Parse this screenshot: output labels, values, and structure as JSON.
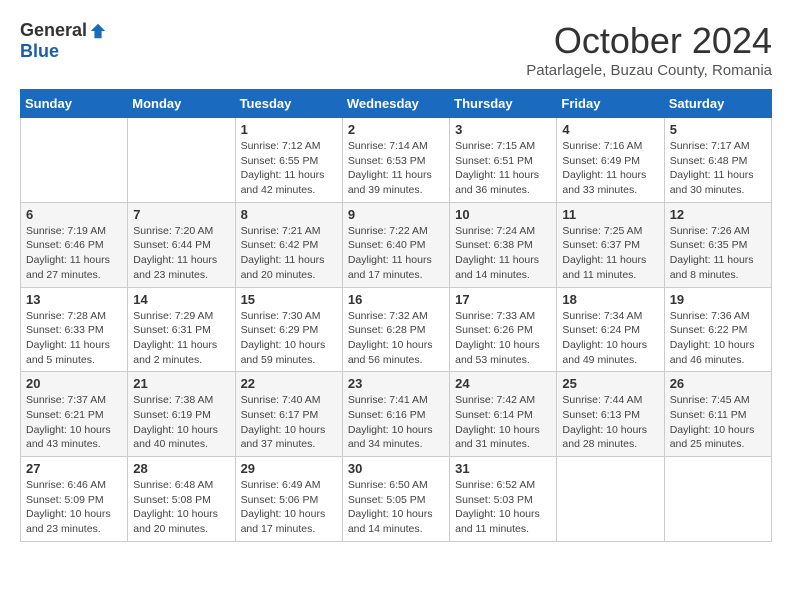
{
  "logo": {
    "general": "General",
    "blue": "Blue"
  },
  "title": "October 2024",
  "location": "Patarlagele, Buzau County, Romania",
  "weekdays": [
    "Sunday",
    "Monday",
    "Tuesday",
    "Wednesday",
    "Thursday",
    "Friday",
    "Saturday"
  ],
  "weeks": [
    [
      {
        "day": "",
        "sunrise": "",
        "sunset": "",
        "daylight": ""
      },
      {
        "day": "",
        "sunrise": "",
        "sunset": "",
        "daylight": ""
      },
      {
        "day": "1",
        "sunrise": "Sunrise: 7:12 AM",
        "sunset": "Sunset: 6:55 PM",
        "daylight": "Daylight: 11 hours and 42 minutes."
      },
      {
        "day": "2",
        "sunrise": "Sunrise: 7:14 AM",
        "sunset": "Sunset: 6:53 PM",
        "daylight": "Daylight: 11 hours and 39 minutes."
      },
      {
        "day": "3",
        "sunrise": "Sunrise: 7:15 AM",
        "sunset": "Sunset: 6:51 PM",
        "daylight": "Daylight: 11 hours and 36 minutes."
      },
      {
        "day": "4",
        "sunrise": "Sunrise: 7:16 AM",
        "sunset": "Sunset: 6:49 PM",
        "daylight": "Daylight: 11 hours and 33 minutes."
      },
      {
        "day": "5",
        "sunrise": "Sunrise: 7:17 AM",
        "sunset": "Sunset: 6:48 PM",
        "daylight": "Daylight: 11 hours and 30 minutes."
      }
    ],
    [
      {
        "day": "6",
        "sunrise": "Sunrise: 7:19 AM",
        "sunset": "Sunset: 6:46 PM",
        "daylight": "Daylight: 11 hours and 27 minutes."
      },
      {
        "day": "7",
        "sunrise": "Sunrise: 7:20 AM",
        "sunset": "Sunset: 6:44 PM",
        "daylight": "Daylight: 11 hours and 23 minutes."
      },
      {
        "day": "8",
        "sunrise": "Sunrise: 7:21 AM",
        "sunset": "Sunset: 6:42 PM",
        "daylight": "Daylight: 11 hours and 20 minutes."
      },
      {
        "day": "9",
        "sunrise": "Sunrise: 7:22 AM",
        "sunset": "Sunset: 6:40 PM",
        "daylight": "Daylight: 11 hours and 17 minutes."
      },
      {
        "day": "10",
        "sunrise": "Sunrise: 7:24 AM",
        "sunset": "Sunset: 6:38 PM",
        "daylight": "Daylight: 11 hours and 14 minutes."
      },
      {
        "day": "11",
        "sunrise": "Sunrise: 7:25 AM",
        "sunset": "Sunset: 6:37 PM",
        "daylight": "Daylight: 11 hours and 11 minutes."
      },
      {
        "day": "12",
        "sunrise": "Sunrise: 7:26 AM",
        "sunset": "Sunset: 6:35 PM",
        "daylight": "Daylight: 11 hours and 8 minutes."
      }
    ],
    [
      {
        "day": "13",
        "sunrise": "Sunrise: 7:28 AM",
        "sunset": "Sunset: 6:33 PM",
        "daylight": "Daylight: 11 hours and 5 minutes."
      },
      {
        "day": "14",
        "sunrise": "Sunrise: 7:29 AM",
        "sunset": "Sunset: 6:31 PM",
        "daylight": "Daylight: 11 hours and 2 minutes."
      },
      {
        "day": "15",
        "sunrise": "Sunrise: 7:30 AM",
        "sunset": "Sunset: 6:29 PM",
        "daylight": "Daylight: 10 hours and 59 minutes."
      },
      {
        "day": "16",
        "sunrise": "Sunrise: 7:32 AM",
        "sunset": "Sunset: 6:28 PM",
        "daylight": "Daylight: 10 hours and 56 minutes."
      },
      {
        "day": "17",
        "sunrise": "Sunrise: 7:33 AM",
        "sunset": "Sunset: 6:26 PM",
        "daylight": "Daylight: 10 hours and 53 minutes."
      },
      {
        "day": "18",
        "sunrise": "Sunrise: 7:34 AM",
        "sunset": "Sunset: 6:24 PM",
        "daylight": "Daylight: 10 hours and 49 minutes."
      },
      {
        "day": "19",
        "sunrise": "Sunrise: 7:36 AM",
        "sunset": "Sunset: 6:22 PM",
        "daylight": "Daylight: 10 hours and 46 minutes."
      }
    ],
    [
      {
        "day": "20",
        "sunrise": "Sunrise: 7:37 AM",
        "sunset": "Sunset: 6:21 PM",
        "daylight": "Daylight: 10 hours and 43 minutes."
      },
      {
        "day": "21",
        "sunrise": "Sunrise: 7:38 AM",
        "sunset": "Sunset: 6:19 PM",
        "daylight": "Daylight: 10 hours and 40 minutes."
      },
      {
        "day": "22",
        "sunrise": "Sunrise: 7:40 AM",
        "sunset": "Sunset: 6:17 PM",
        "daylight": "Daylight: 10 hours and 37 minutes."
      },
      {
        "day": "23",
        "sunrise": "Sunrise: 7:41 AM",
        "sunset": "Sunset: 6:16 PM",
        "daylight": "Daylight: 10 hours and 34 minutes."
      },
      {
        "day": "24",
        "sunrise": "Sunrise: 7:42 AM",
        "sunset": "Sunset: 6:14 PM",
        "daylight": "Daylight: 10 hours and 31 minutes."
      },
      {
        "day": "25",
        "sunrise": "Sunrise: 7:44 AM",
        "sunset": "Sunset: 6:13 PM",
        "daylight": "Daylight: 10 hours and 28 minutes."
      },
      {
        "day": "26",
        "sunrise": "Sunrise: 7:45 AM",
        "sunset": "Sunset: 6:11 PM",
        "daylight": "Daylight: 10 hours and 25 minutes."
      }
    ],
    [
      {
        "day": "27",
        "sunrise": "Sunrise: 6:46 AM",
        "sunset": "Sunset: 5:09 PM",
        "daylight": "Daylight: 10 hours and 23 minutes."
      },
      {
        "day": "28",
        "sunrise": "Sunrise: 6:48 AM",
        "sunset": "Sunset: 5:08 PM",
        "daylight": "Daylight: 10 hours and 20 minutes."
      },
      {
        "day": "29",
        "sunrise": "Sunrise: 6:49 AM",
        "sunset": "Sunset: 5:06 PM",
        "daylight": "Daylight: 10 hours and 17 minutes."
      },
      {
        "day": "30",
        "sunrise": "Sunrise: 6:50 AM",
        "sunset": "Sunset: 5:05 PM",
        "daylight": "Daylight: 10 hours and 14 minutes."
      },
      {
        "day": "31",
        "sunrise": "Sunrise: 6:52 AM",
        "sunset": "Sunset: 5:03 PM",
        "daylight": "Daylight: 10 hours and 11 minutes."
      },
      {
        "day": "",
        "sunrise": "",
        "sunset": "",
        "daylight": ""
      },
      {
        "day": "",
        "sunrise": "",
        "sunset": "",
        "daylight": ""
      }
    ]
  ]
}
